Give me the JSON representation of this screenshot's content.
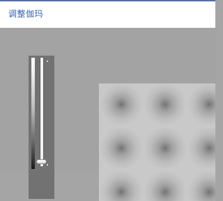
{
  "window": {
    "title": "调整伽玛"
  },
  "gamma_slider": {
    "level": 0.02
  },
  "colors": {
    "title_text": "#2f5fb3",
    "accent_bar": "#4d6fb3",
    "background": "#a3a3a3",
    "panel": "#727272"
  }
}
